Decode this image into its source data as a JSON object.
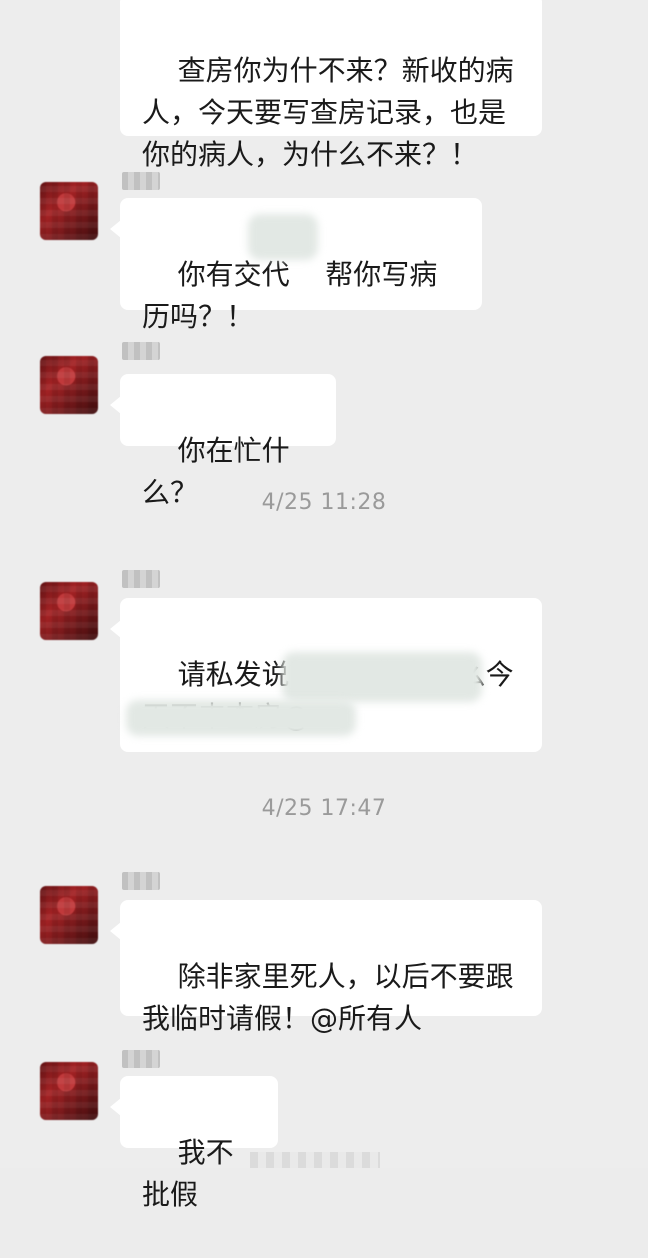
{
  "messages": [
    {
      "text": "查房你为什不来？新收的病人，今天要写查房记录，也是你的病人，为什么不来？！"
    },
    {
      "text": "你有交代    帮你写病历吗？！"
    },
    {
      "text": "你在忙什么？"
    },
    {
      "text": "请私发说明一下你为什么今天不来查房@"
    },
    {
      "text": "除非家里死人，以后不要跟我临时请假！@所有人"
    },
    {
      "text": "我不批假"
    }
  ],
  "timestamps": [
    "4/25 11:28",
    "4/25 17:47"
  ],
  "colors": {
    "background": "#ededed",
    "bubble": "#ffffff",
    "text": "#1a1a1a",
    "timestamp": "#9a9a9a"
  }
}
